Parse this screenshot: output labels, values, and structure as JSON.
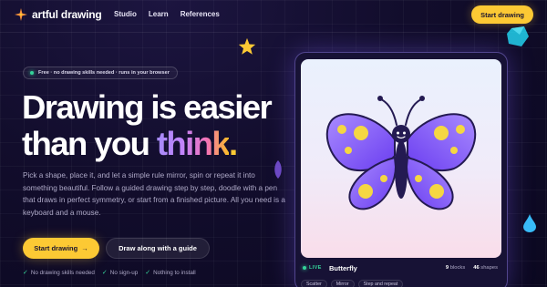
{
  "brand": {
    "name": "artful drawing",
    "icon": "sparkle-icon"
  },
  "nav": {
    "links": [
      "Studio",
      "Learn",
      "References"
    ],
    "cta": "Start drawing"
  },
  "hero": {
    "pill": "Free · no drawing skills needed · runs in your browser",
    "headline_line1": "Drawing is easier",
    "headline_line2_prefix": "than you ",
    "headline_line2_accent": "think",
    "headline_line2_end": ".",
    "description": "Pick a shape, place it, and let a simple rule mirror, spin or repeat it into something beautiful. Follow a guided drawing step by step, doodle with a pen that draws in perfect symmetry, or start from a finished picture. All you need is a keyboard and a mouse.",
    "primary_button": "Start drawing",
    "primary_button_arrow": "→",
    "secondary_button": "Draw along with a guide",
    "checks": [
      {
        "mark": "✓",
        "text": "No drawing skills needed"
      },
      {
        "mark": "✓",
        "text": "No sign-up"
      },
      {
        "mark": "✓",
        "text": "Nothing to install"
      }
    ]
  },
  "card": {
    "live_label": "LIVE",
    "title": "Butterfly",
    "blocks_count": "9",
    "blocks_label": "blocks",
    "shapes_count": "46",
    "shapes_label": "shapes",
    "tags": [
      "Scatter",
      "Mirror",
      "Step and repeat"
    ]
  },
  "colors": {
    "accent_yellow": "#fcc934",
    "live_green": "#34d399",
    "wing_purple": "#7c4dff",
    "wing_dot": "#f5d742",
    "body": "#241a52"
  }
}
